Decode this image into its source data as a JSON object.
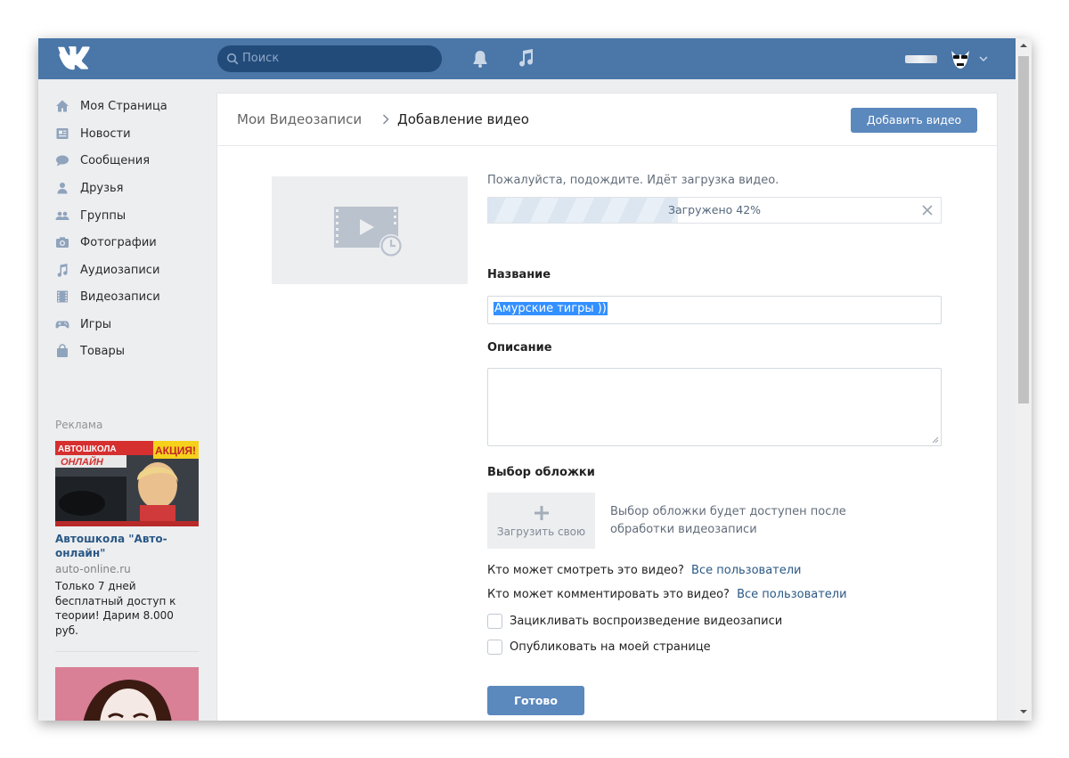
{
  "header": {
    "search_placeholder": "Поиск",
    "accent_color": "#4a76a8"
  },
  "sidebar": {
    "items": [
      {
        "label": "Моя Страница",
        "icon": "home-icon"
      },
      {
        "label": "Новости",
        "icon": "news-icon"
      },
      {
        "label": "Сообщения",
        "icon": "messages-icon"
      },
      {
        "label": "Друзья",
        "icon": "friends-icon"
      },
      {
        "label": "Группы",
        "icon": "groups-icon"
      },
      {
        "label": "Фотографии",
        "icon": "camera-icon"
      },
      {
        "label": "Аудиозаписи",
        "icon": "music-note-icon"
      },
      {
        "label": "Видеозаписи",
        "icon": "film-icon"
      },
      {
        "label": "Игры",
        "icon": "gamepad-icon"
      },
      {
        "label": "Товары",
        "icon": "shopping-bag-icon"
      }
    ],
    "ad_label": "Реклама",
    "ad": {
      "banner_text_1": "АВТОШКОЛА",
      "banner_text_2": "ОНЛАЙН",
      "banner_text_3": "АКЦИЯ!",
      "title": "Автошкола \"Авто-онлайн\"",
      "domain": "auto-online.ru",
      "text": "Только 7 дней бесплатный доступ к теории! Дарим 8.000 руб."
    }
  },
  "page": {
    "breadcrumb_parent": "Мои Видеозаписи",
    "breadcrumb_current": "Добавление видео",
    "add_video_button": "Добавить видео",
    "upload_status": "Пожалуйста, подождите. Идёт загрузка видео.",
    "progress_text": "Загружено 42%",
    "progress_percent": 42,
    "title_label": "Название",
    "title_value": "Амурские тигры ))",
    "description_label": "Описание",
    "description_value": "",
    "cover_label": "Выбор обложки",
    "cover_upload_button": "Загрузить свою",
    "cover_note": "Выбор обложки будет доступен после обработки видеозаписи",
    "view_privacy_question": "Кто может смотреть это видео?",
    "view_privacy_value": "Все пользователи",
    "comment_privacy_question": "Кто может комментировать это видео?",
    "comment_privacy_value": "Все пользователи",
    "loop_checkbox_label": "Зацикливать воспроизведение видеозаписи",
    "publish_checkbox_label": "Опубликовать на моей странице",
    "done_button": "Готово"
  }
}
